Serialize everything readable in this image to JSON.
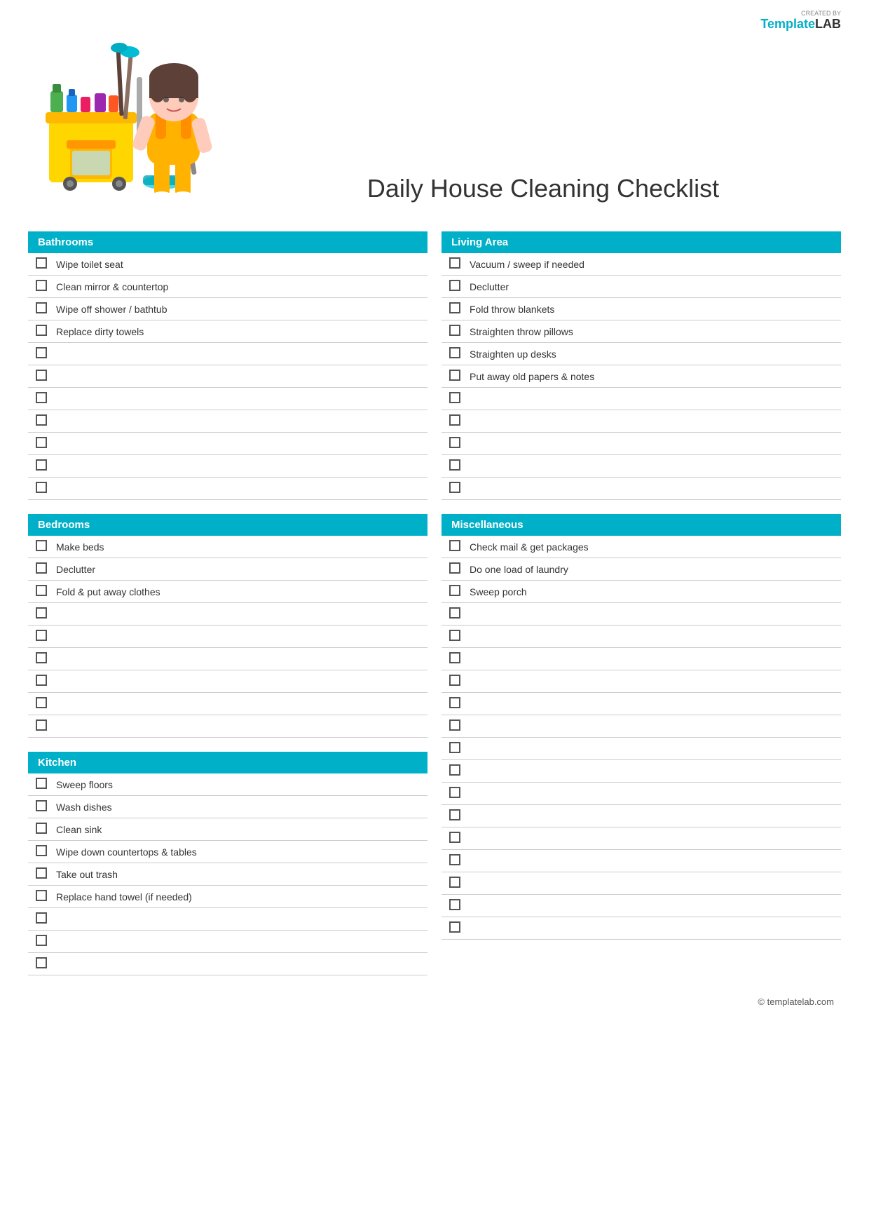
{
  "brand": {
    "created_by": "CREATED BY",
    "name_template": "Template",
    "name_lab": "LAB"
  },
  "title": "Daily House Cleaning Checklist",
  "sections": {
    "bathrooms": {
      "label": "Bathrooms",
      "items": [
        "Wipe toilet seat",
        "Clean mirror & countertop",
        "Wipe off shower / bathtub",
        "Replace dirty towels",
        "",
        "",
        "",
        "",
        "",
        "",
        ""
      ]
    },
    "living_area": {
      "label": "Living Area",
      "items": [
        "Vacuum / sweep if needed",
        "Declutter",
        "Fold throw blankets",
        "Straighten throw pillows",
        "Straighten up desks",
        "Put away old papers & notes",
        "",
        "",
        "",
        "",
        ""
      ]
    },
    "bedrooms": {
      "label": "Bedrooms",
      "items": [
        "Make beds",
        "Declutter",
        "Fold & put away clothes",
        "",
        "",
        "",
        "",
        "",
        ""
      ]
    },
    "miscellaneous": {
      "label": "Miscellaneous",
      "items": [
        "Check mail & get packages",
        "Do one load of laundry",
        "Sweep porch",
        "",
        "",
        "",
        "",
        "",
        "",
        "",
        "",
        "",
        "",
        "",
        ""
      ]
    },
    "kitchen": {
      "label": "Kitchen",
      "items": [
        "Sweep floors",
        "Wash dishes",
        "Clean sink",
        "Wipe down countertops & tables",
        "Take out trash",
        "Replace hand towel (if needed)",
        "",
        "",
        ""
      ]
    }
  },
  "footer": {
    "copyright": "© templatelab.com"
  }
}
